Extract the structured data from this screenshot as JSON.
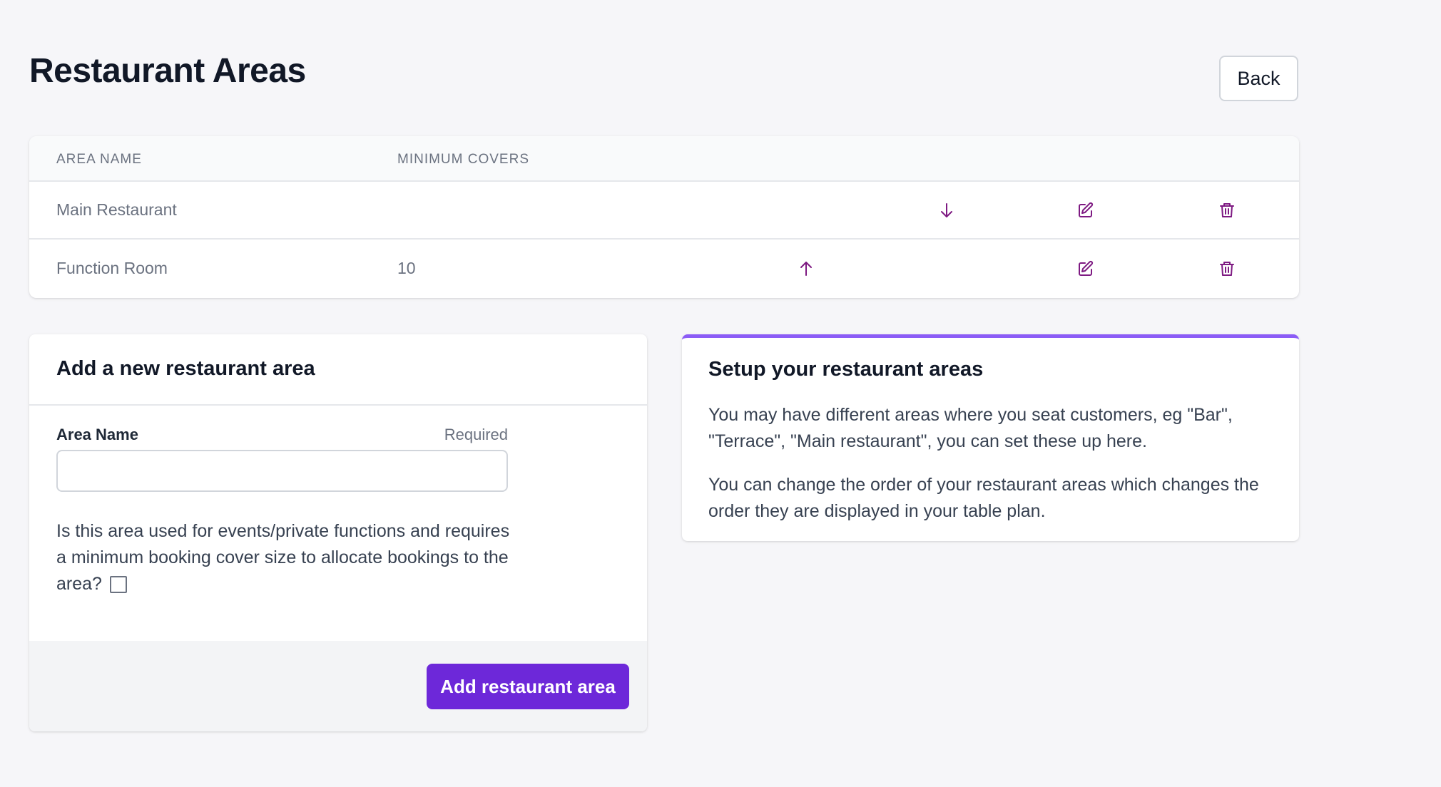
{
  "page": {
    "title": "Restaurant Areas",
    "back_label": "Back"
  },
  "table": {
    "headers": [
      "AREA NAME",
      "MINIMUM COVERS"
    ],
    "rows": [
      {
        "name": "Main Restaurant",
        "min_covers": "",
        "move": "move-down"
      },
      {
        "name": "Function Room",
        "min_covers": "10",
        "move": "move-up"
      }
    ]
  },
  "form": {
    "title": "Add a new restaurant area",
    "area_name_label": "Area Name",
    "required_label": "Required",
    "area_name_value": "",
    "question": "Is this area used for events/private functions and requires a minimum booking cover size to allocate bookings to the area?",
    "checkbox_checked": false,
    "submit_label": "Add restaurant area"
  },
  "info": {
    "title": "Setup your restaurant areas",
    "p1": "You may have different areas where you seat customers, eg \"Bar\", \"Terrace\", \"Main restaurant\", you can set these up here.",
    "p2": "You can change the order of your restaurant areas which changes the order they are displayed in your table plan."
  },
  "colors": {
    "accent": "#6d28d9",
    "icon": "#7e1a82",
    "info_border": "#8b5cf6"
  }
}
